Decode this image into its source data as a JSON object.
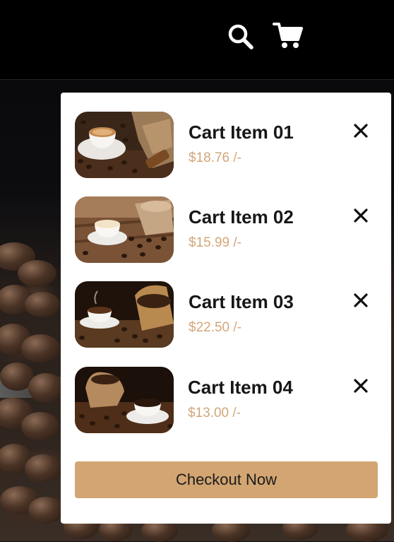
{
  "header": {
    "icons": [
      "search-icon",
      "cart-icon"
    ]
  },
  "cart": {
    "items": [
      {
        "name": "Cart Item 01",
        "price": "$18.76 /-",
        "icon": "close-icon"
      },
      {
        "name": "Cart Item 02",
        "price": "$15.99 /-",
        "icon": "close-icon"
      },
      {
        "name": "Cart Item 03",
        "price": "$22.50 /-",
        "icon": "close-icon"
      },
      {
        "name": "Cart Item 04",
        "price": "$13.00 /-",
        "icon": "close-icon"
      }
    ],
    "checkout_label": "Checkout Now"
  },
  "colors": {
    "accent": "#d3a572",
    "price": "#d2a679",
    "header_bg": "#000000",
    "panel_bg": "#ffffff"
  }
}
